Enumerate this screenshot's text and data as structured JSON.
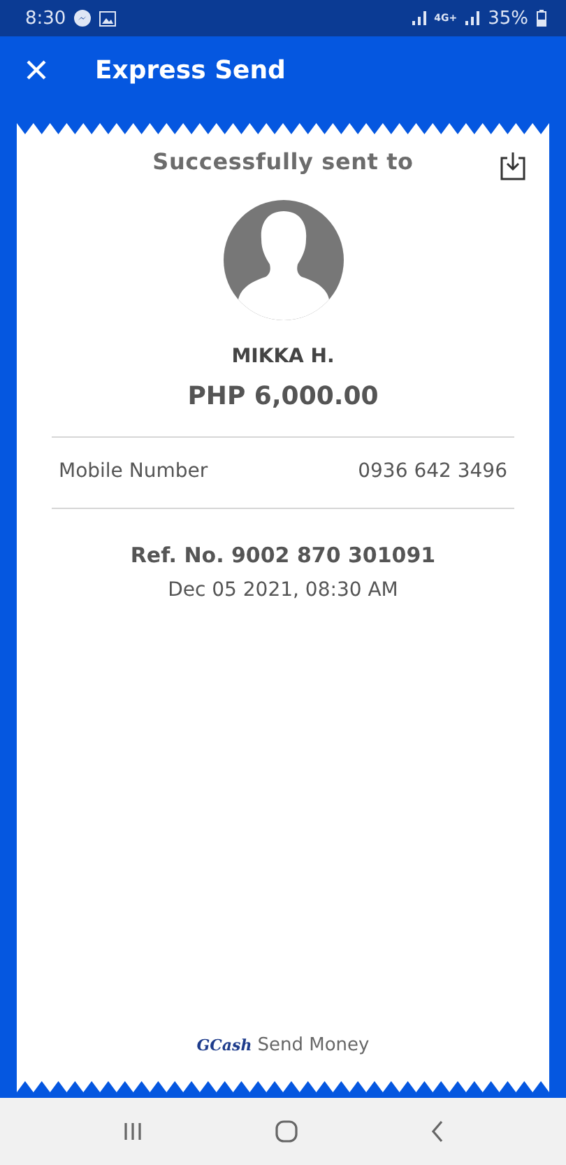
{
  "status_bar": {
    "time": "8:30",
    "network": "4G+",
    "battery": "35%"
  },
  "app_bar": {
    "title": "Express Send"
  },
  "receipt": {
    "heading": "Successfully sent to",
    "name": "MIKKA H.",
    "amount": "PHP 6,000.00",
    "details": [
      {
        "label": "Mobile Number",
        "value": "0936 642 3496"
      }
    ],
    "reference": "Ref. No. 9002 870 301091",
    "date": "Dec 05 2021, 08:30 AM",
    "footer": {
      "brand": "GCash",
      "label": "Send Money"
    }
  }
}
